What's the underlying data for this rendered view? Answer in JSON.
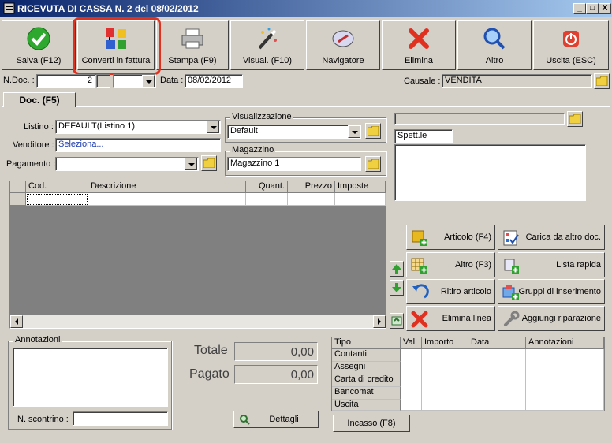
{
  "window": {
    "title": "RICEVUTA DI CASSA N. 2  del 08/02/2012",
    "minimize": "_",
    "maximize": "□",
    "close": "X"
  },
  "toolbar": [
    {
      "label": "Salva (F12)",
      "icon": "check-icon"
    },
    {
      "label": "Converti in fattura",
      "icon": "convert-icon"
    },
    {
      "label": "Stampa (F9)",
      "icon": "printer-icon"
    },
    {
      "label": "Visual. (F10)",
      "icon": "magic-wand-icon"
    },
    {
      "label": "Navigatore",
      "icon": "compass-icon"
    },
    {
      "label": "Elimina",
      "icon": "delete-x-icon"
    },
    {
      "label": "Altro",
      "icon": "magnifier-icon"
    },
    {
      "label": "Uscita (ESC)",
      "icon": "power-icon"
    }
  ],
  "header": {
    "ndoc_label": "N.Doc. :",
    "ndoc_value": "2",
    "data_label": "Data :",
    "data_value": "08/02/2012",
    "causale_label": "Causale :",
    "causale_value": "VENDITA"
  },
  "tab": {
    "label": "Doc. (F5)"
  },
  "form": {
    "listino_label": "Listino :",
    "listino_value": "DEFAULT(Listino 1)",
    "venditore_label": "Venditore :",
    "venditore_value": "Seleziona...",
    "pagamento_label": "Pagamento :",
    "pagamento_value": "",
    "visualizzazione_title": "Visualizzazione",
    "visualizzazione_value": "Default",
    "magazzino_title": "Magazzino",
    "magazzino_value": "Magazzino 1"
  },
  "customer": {
    "name_value": "",
    "spett_value": "Spett.le",
    "address_value": ""
  },
  "grid": {
    "columns": [
      "Cod.",
      "Descrizione",
      "Quant.",
      "Prezzo",
      "Imposte"
    ]
  },
  "actions": [
    {
      "label": "Articolo (F4)",
      "icon": "box-add-icon"
    },
    {
      "label": "Carica da altro doc.",
      "icon": "checklist-icon"
    },
    {
      "label": "Altro (F3)",
      "icon": "table-add-icon"
    },
    {
      "label": "Lista rapida",
      "icon": "list-add-icon"
    },
    {
      "label": "Ritiro articolo",
      "icon": "undo-arrow-icon"
    },
    {
      "label": "Gruppi di inserimento",
      "icon": "group-add-icon"
    },
    {
      "label": "Elimina linea",
      "icon": "delete-x-icon"
    },
    {
      "label": "Aggiungi riparazione",
      "icon": "wrench-icon"
    }
  ],
  "notes": {
    "title": "Annotazioni",
    "scontrino_label": "N. scontrino :",
    "scontrino_value": ""
  },
  "totals": {
    "totale_label": "Totale",
    "totale_value": "0,00",
    "pagato_label": "Pagato",
    "pagato_value": "0,00",
    "dettagli_label": "Dettagli"
  },
  "payments": {
    "columns": [
      "Tipo",
      "Val",
      "Importo",
      "Data",
      "Annotazioni"
    ],
    "rows": [
      "Contanti",
      "Assegni",
      "Carta di credito",
      "Bancomat",
      "Uscita"
    ],
    "incasso_label": "Incasso (F8)"
  }
}
